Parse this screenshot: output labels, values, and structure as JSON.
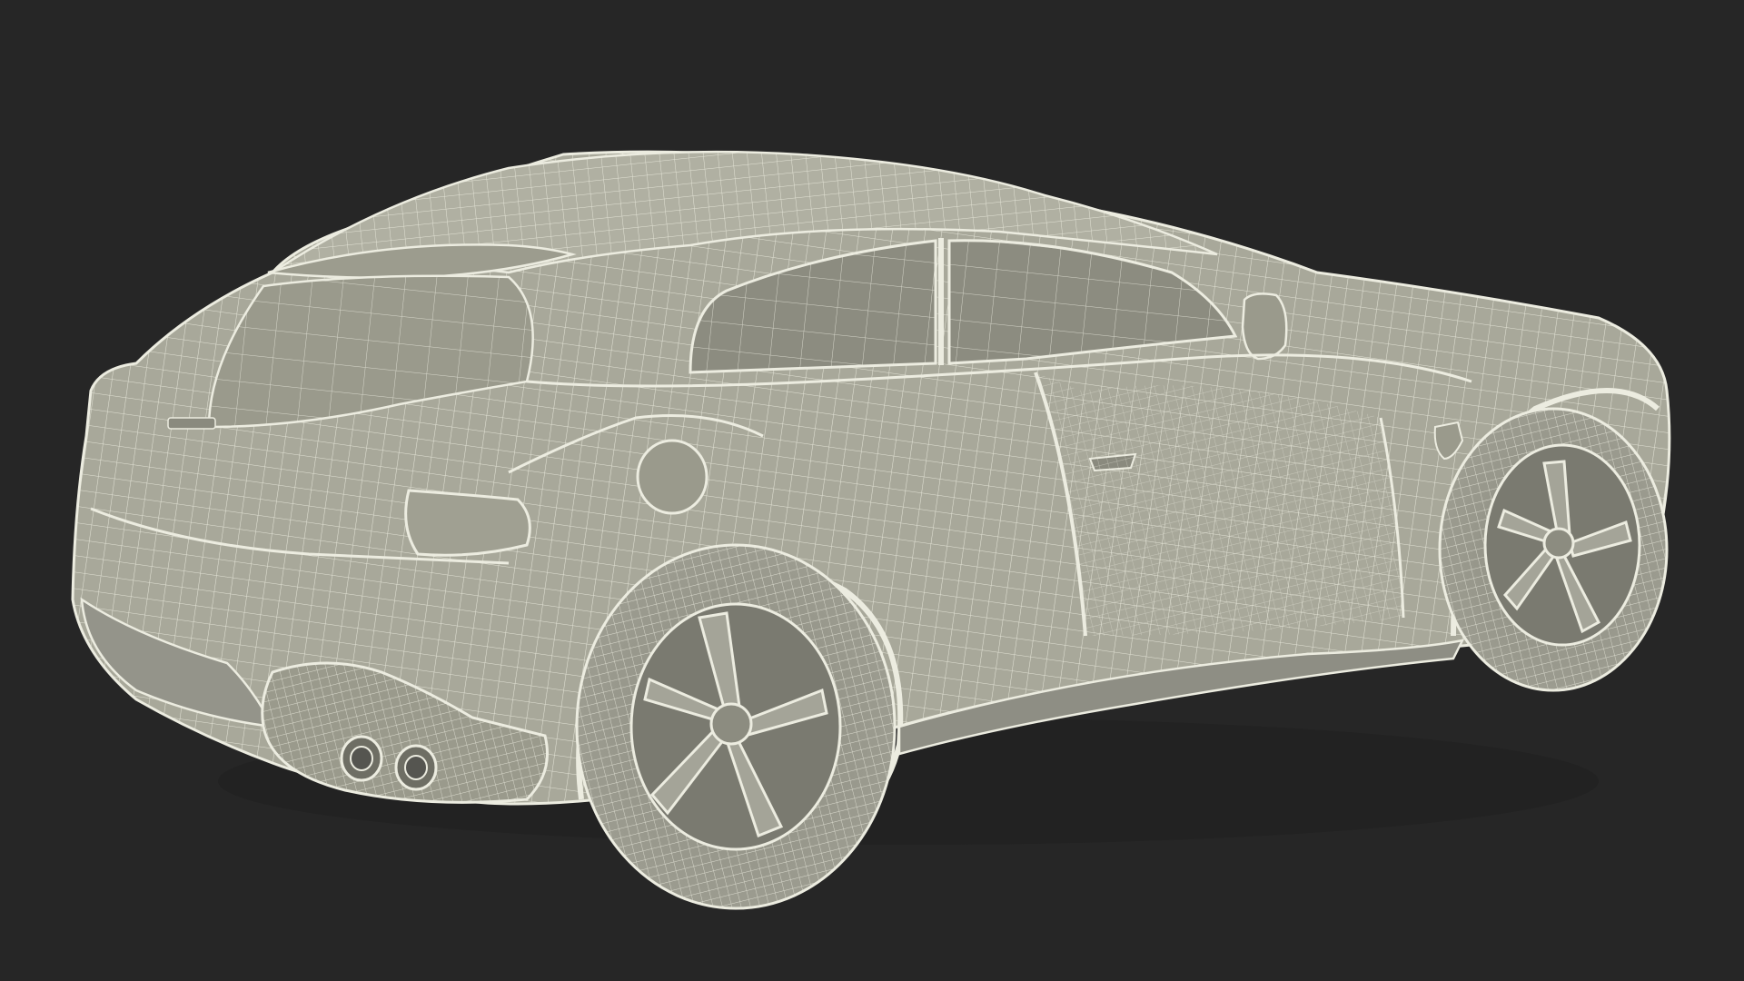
{
  "scene": {
    "background_color": "#262626",
    "surface_color": "#a8a89a",
    "wire_color": "#ecece0",
    "shadow_color": "#6e6e64",
    "subject": "car-wireframe-render"
  },
  "logos": {
    "rear_badge": "rear-brand-badge-icon",
    "side_badge": "side-emblem-icon"
  }
}
